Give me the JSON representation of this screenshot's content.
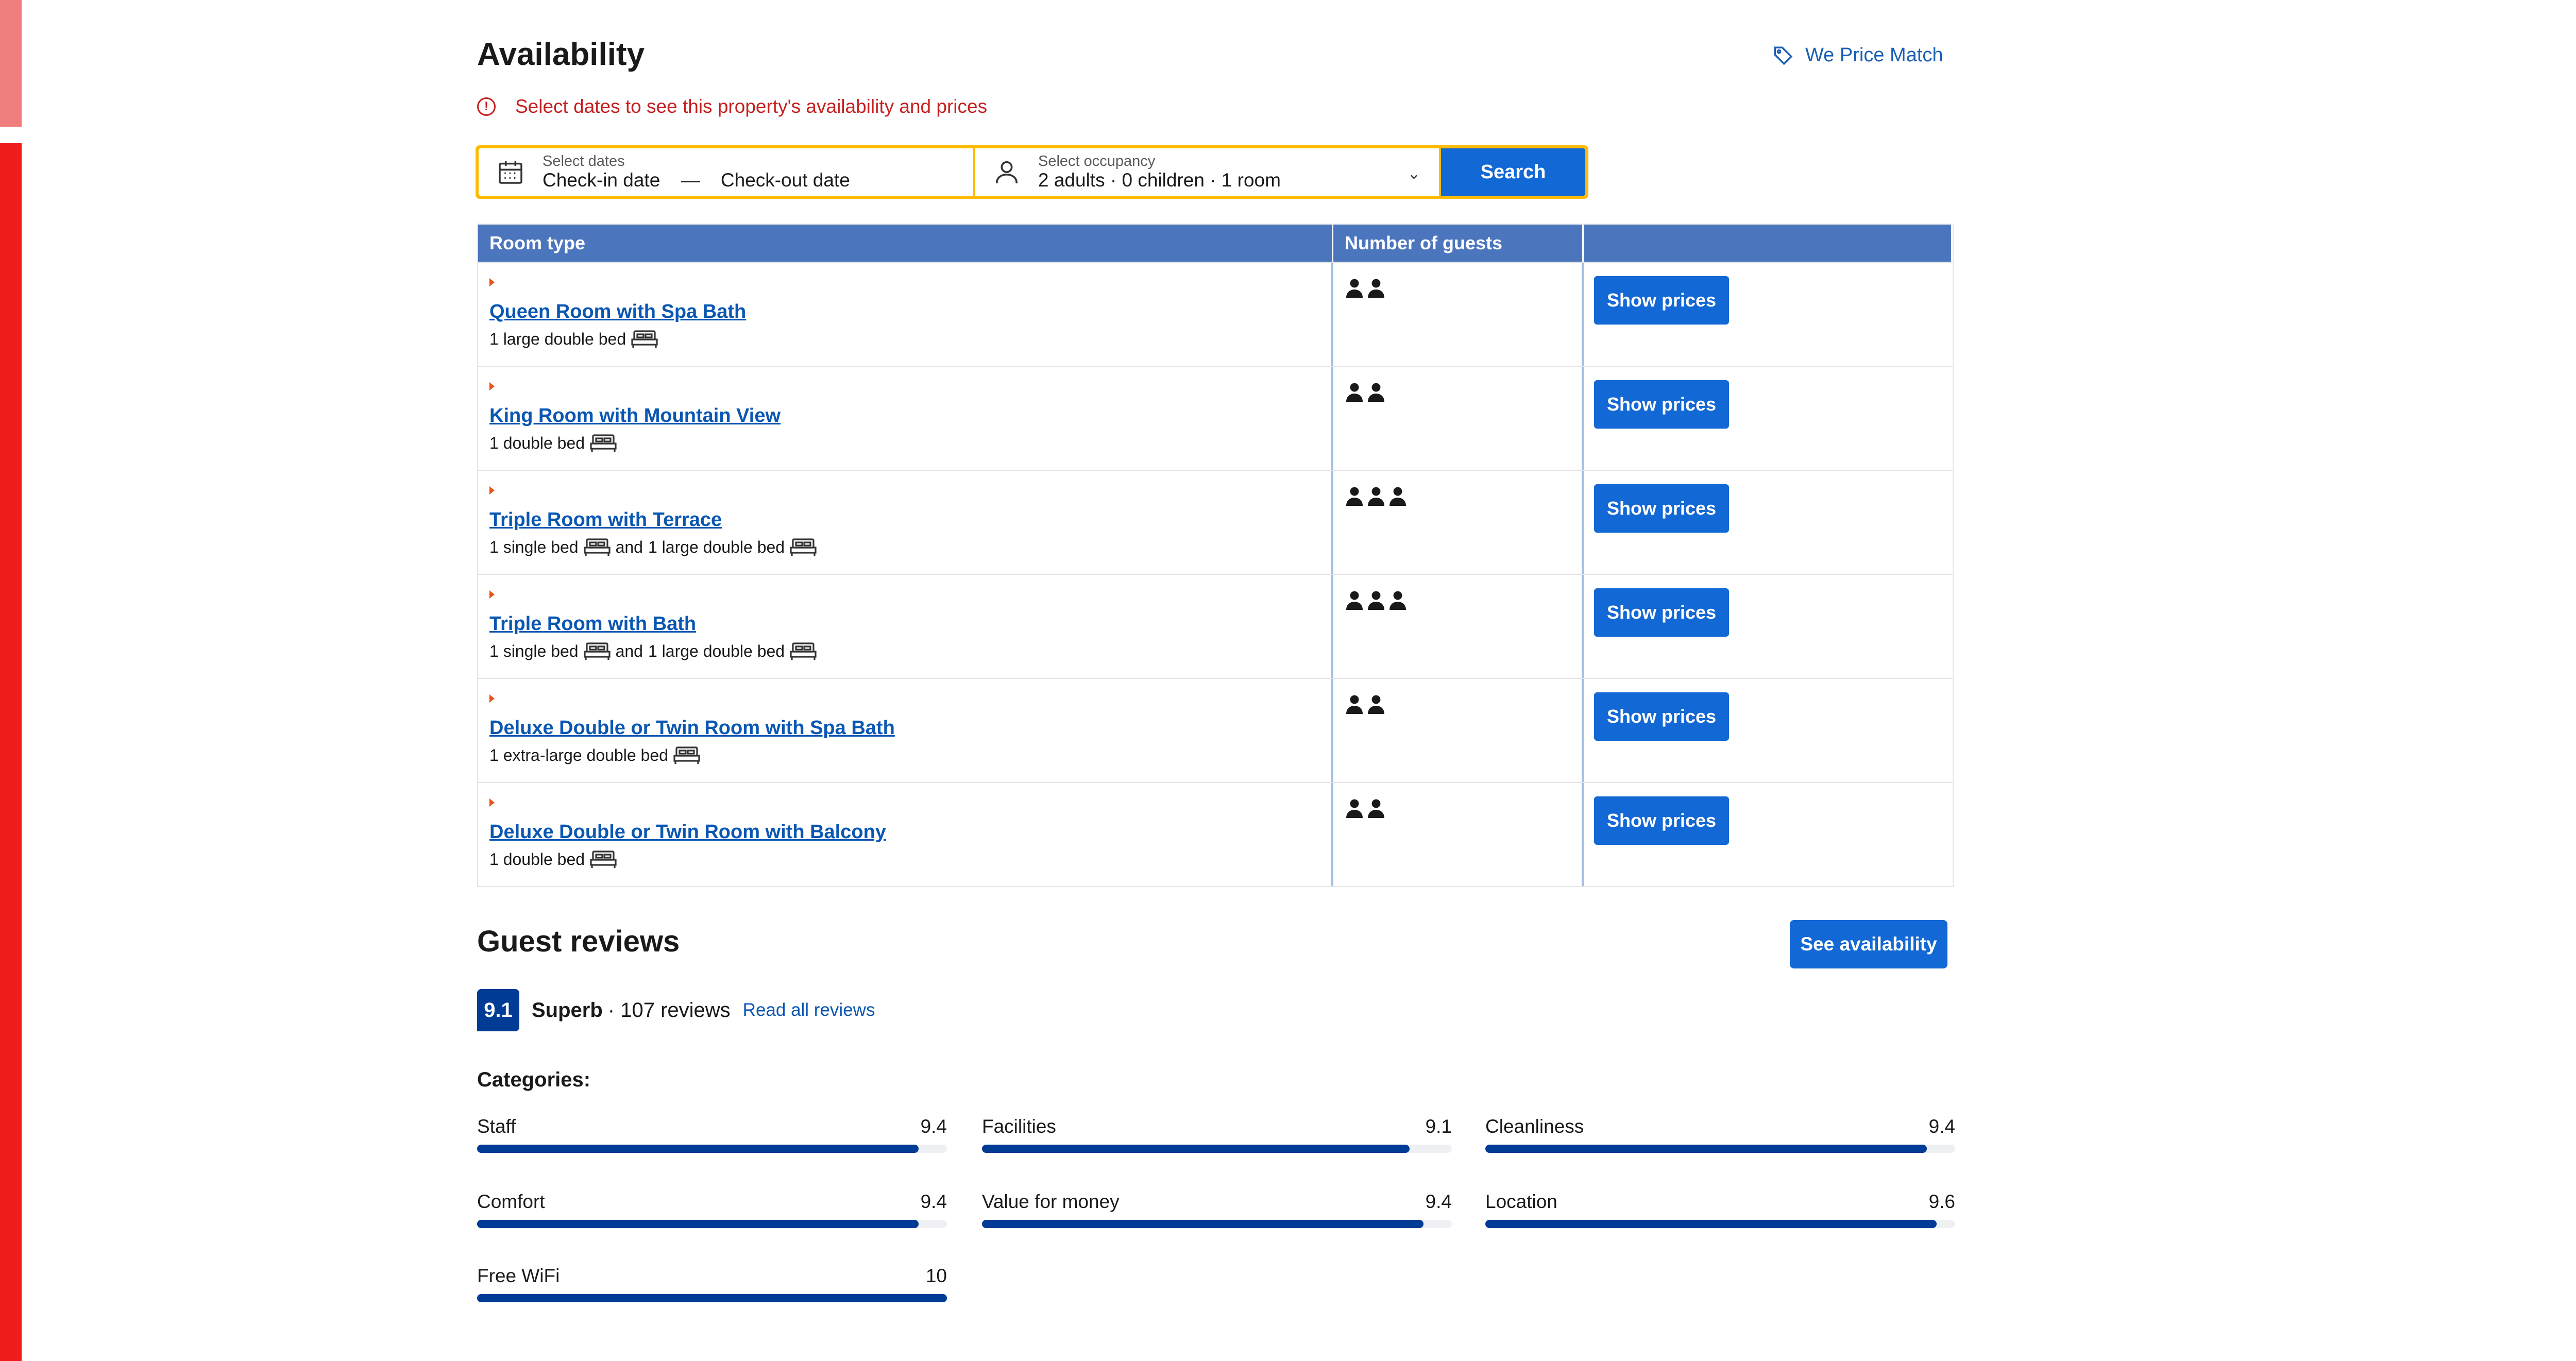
{
  "availability": {
    "title": "Availability",
    "price_match": "We Price Match",
    "alert": "Select dates to see this property's availability and prices"
  },
  "search": {
    "dates_label": "Select dates",
    "checkin": "Check-in date",
    "separator": "—",
    "checkout": "Check-out date",
    "occupancy_label": "Select occupancy",
    "occupancy_value": "2 adults · 0 children · 1 room",
    "button": "Search"
  },
  "table": {
    "headers": [
      "Room type",
      "Number of guests",
      ""
    ],
    "show_prices": "Show prices",
    "and": "and",
    "rooms": [
      {
        "name": "Queen Room with Spa Bath",
        "beds": [
          "1 large double bed"
        ],
        "guests": 2
      },
      {
        "name": "King Room with Mountain View",
        "beds": [
          "1 double bed"
        ],
        "guests": 2
      },
      {
        "name": "Triple Room with Terrace",
        "beds": [
          "1 single bed",
          "1 large double bed"
        ],
        "guests": 3
      },
      {
        "name": "Triple Room with Bath",
        "beds": [
          "1 single bed",
          "1 large double bed"
        ],
        "guests": 3
      },
      {
        "name": "Deluxe Double or Twin Room with Spa Bath",
        "beds": [
          "1 extra-large double bed"
        ],
        "guests": 2
      },
      {
        "name": "Deluxe Double or Twin Room with Balcony",
        "beds": [
          "1 double bed"
        ],
        "guests": 2
      }
    ]
  },
  "reviews": {
    "title": "Guest reviews",
    "see_availability": "See availability",
    "score": "9.1",
    "score_word": "Superb",
    "count": "· 107 reviews",
    "read_all": "Read all reviews",
    "categories_title": "Categories:",
    "categories": [
      {
        "name": "Staff",
        "score": "9.4",
        "value": 9.4
      },
      {
        "name": "Facilities",
        "score": "9.1",
        "value": 9.1
      },
      {
        "name": "Cleanliness",
        "score": "9.4",
        "value": 9.4
      },
      {
        "name": "Comfort",
        "score": "9.4",
        "value": 9.4
      },
      {
        "name": "Value for money",
        "score": "9.4",
        "value": 9.4
      },
      {
        "name": "Location",
        "score": "9.6",
        "value": 9.6
      },
      {
        "name": "Free WiFi",
        "score": "10",
        "value": 10
      }
    ]
  },
  "colors": {
    "brand_blue": "#1268d4",
    "dark_blue": "#003b95",
    "search_border": "#febb02",
    "alert_red": "#c61f1f",
    "edge_red": "#ef1c1c"
  },
  "icons": [
    "tag-icon",
    "alert-icon",
    "calendar-icon",
    "person-icon",
    "chevron-down-icon",
    "bed-icon",
    "guest-icon"
  ]
}
